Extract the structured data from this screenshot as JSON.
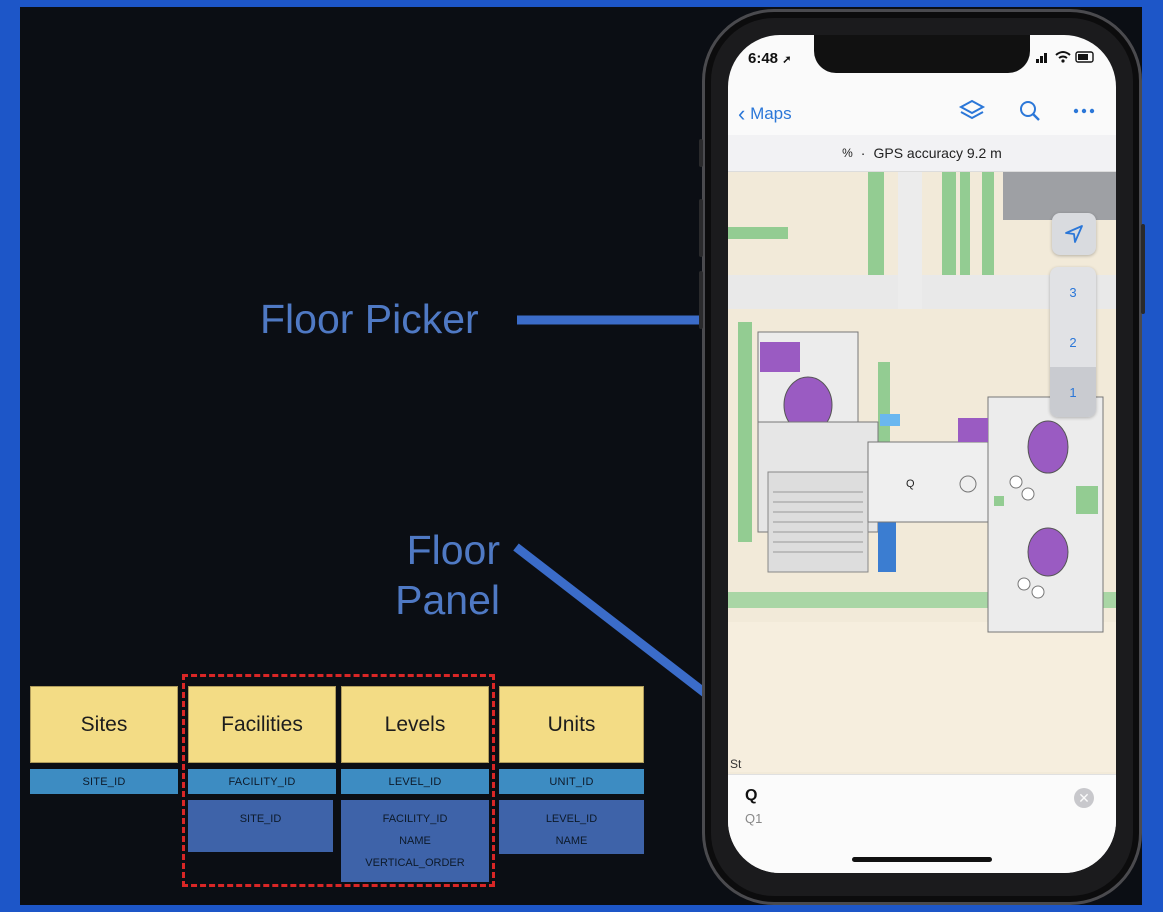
{
  "callouts": {
    "floor_picker": "Floor Picker",
    "floor_panel_line1": "Floor",
    "floor_panel_line2": "Panel"
  },
  "schema": {
    "tables": [
      {
        "name": "Sites",
        "key": "SITE_ID",
        "fields": []
      },
      {
        "name": "Facilities",
        "key": "FACILITY_ID",
        "fields": [
          "SITE_ID"
        ]
      },
      {
        "name": "Levels",
        "key": "LEVEL_ID",
        "fields": [
          "FACILITY_ID",
          "NAME",
          "VERTICAL_ORDER"
        ]
      },
      {
        "name": "Units",
        "key": "UNIT_ID",
        "fields": [
          "LEVEL_ID",
          "NAME"
        ]
      }
    ]
  },
  "phone": {
    "status": {
      "time": "6:48",
      "location_arrow": "➚",
      "icons": "signal-wifi-battery"
    },
    "nav": {
      "back_label": "Maps",
      "icons": [
        "layers-icon",
        "search-icon",
        "more-icon"
      ]
    },
    "gps_text": "GPS accuracy 9.2 m",
    "map": {
      "marker_label": "Q",
      "edge_label": "St"
    },
    "floor_picker": {
      "levels": [
        "3",
        "2",
        "1"
      ],
      "selected": "1"
    },
    "floor_panel": {
      "name": "Q",
      "subtitle": "Q1",
      "close_glyph": "✕"
    }
  },
  "colors": {
    "frame_blue": "#1d56c8",
    "slide_bg": "#0b0e14",
    "callout_text": "#4f79c4",
    "table_header": "#f3dc85",
    "primary_key": "#3d8cc2",
    "foreign_key": "#3e63a9",
    "dashed_group": "#d92626",
    "ios_blue": "#2b77d8",
    "unit_purple": "#9a5bc2",
    "park_green": "#93cc92"
  }
}
